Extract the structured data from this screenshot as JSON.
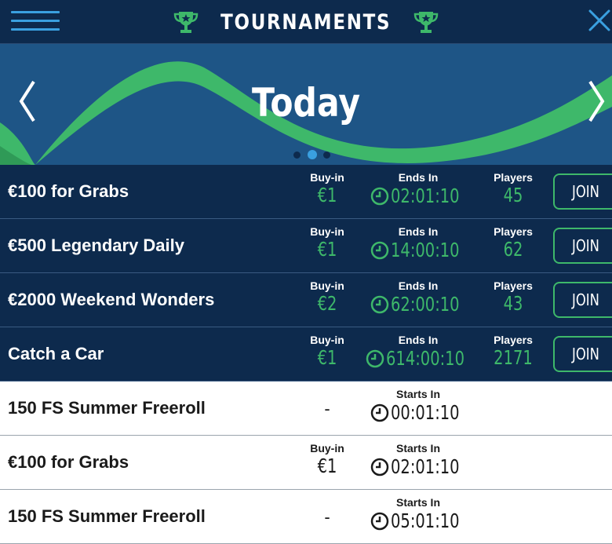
{
  "header": {
    "title": "TOURNAMENTS",
    "menu_icon": "hamburger-icon",
    "close_icon": "close-icon",
    "trophy_icon": "trophy-icon"
  },
  "banner": {
    "title": "Today",
    "prev_icon": "chevron-left-icon",
    "next_icon": "chevron-right-icon",
    "active_page": 2,
    "page_count": 3
  },
  "colors": {
    "header_bg": "#0d2a4d",
    "banner_bg": "#1e5586",
    "accent_green": "#3eb86a",
    "accent_blue": "#3aa0e0"
  },
  "labels": {
    "buyin": "Buy-in",
    "ends_in": "Ends In",
    "starts_in": "Starts In",
    "players": "Players",
    "join": "JOIN",
    "no_buyin": "-"
  },
  "active_tournaments": [
    {
      "name": "€100 for Grabs",
      "buyin": "€1",
      "ends_in": "02:01:10",
      "players": "45"
    },
    {
      "name": "€500 Legendary Daily",
      "buyin": "€1",
      "ends_in": "14:00:10",
      "players": "62"
    },
    {
      "name": "€2000 Weekend Wonders",
      "buyin": "€2",
      "ends_in": "62:00:10",
      "players": "43"
    },
    {
      "name": "Catch a Car",
      "buyin": "€1",
      "ends_in": "614:00:10",
      "players": "2171"
    }
  ],
  "upcoming_tournaments": [
    {
      "name": "150 FS Summer Freeroll",
      "buyin": "-",
      "starts_in": "00:01:10"
    },
    {
      "name": "€100 for Grabs",
      "buyin": "€1",
      "starts_in": "02:01:10"
    },
    {
      "name": "150 FS Summer Freeroll",
      "buyin": "-",
      "starts_in": "05:01:10"
    }
  ]
}
